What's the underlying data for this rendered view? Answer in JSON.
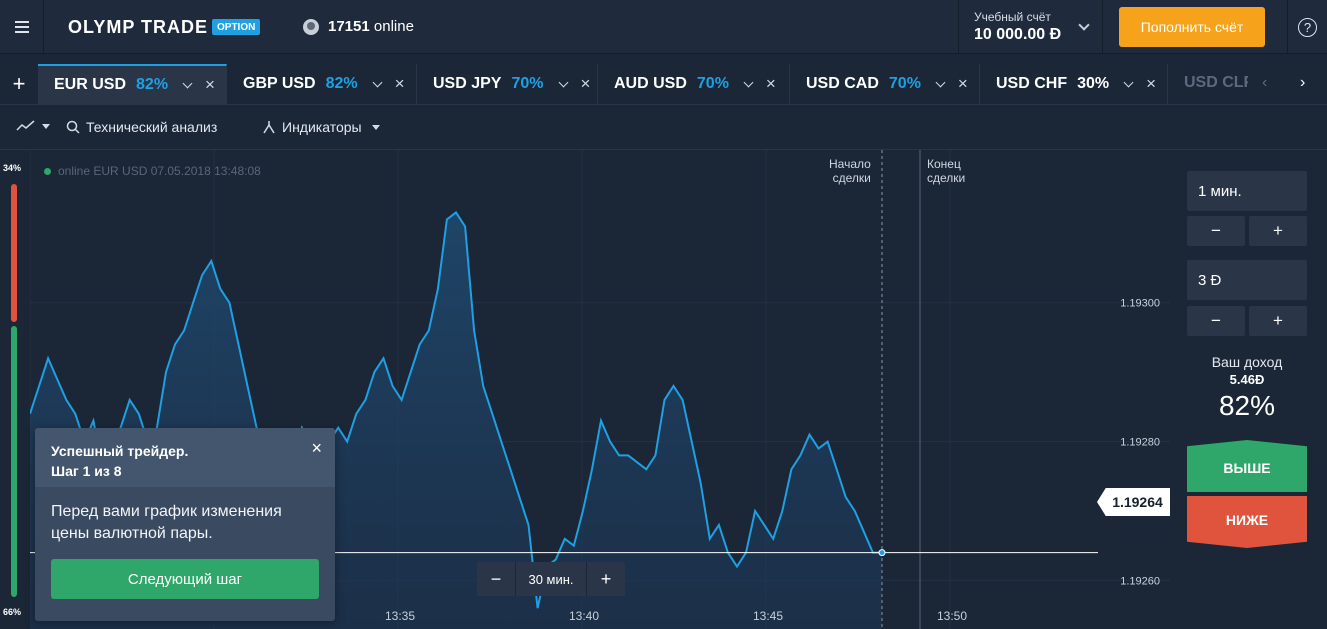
{
  "header": {
    "logo_text": "OLYMP TRADE",
    "logo_badge": "OPTION",
    "online_count": "17151",
    "online_label": "online",
    "account_label": "Учебный счёт",
    "account_balance": "10 000.00 Đ",
    "deposit_label": "Пополнить счёт",
    "help_symbol": "?"
  },
  "tabs": [
    {
      "name": "EUR USD",
      "pct": "82%",
      "active": true
    },
    {
      "name": "GBP USD",
      "pct": "82%"
    },
    {
      "name": "USD JPY",
      "pct": "70%"
    },
    {
      "name": "AUD USD",
      "pct": "70%"
    },
    {
      "name": "USD CAD",
      "pct": "70%"
    },
    {
      "name": "USD CHF",
      "pct": "30%"
    }
  ],
  "tab_faded": "USD CLP",
  "toolbar": {
    "tech_analysis": "Технический анализ",
    "indicators": "Индикаторы"
  },
  "sentiment": {
    "top_pct": "34%",
    "bottom_pct": "66%",
    "up_fraction": 0.66
  },
  "chart_info": "online EUR USD  07.05.2018 13:48:08",
  "deal_start_label": [
    "Начало",
    "сделки"
  ],
  "deal_end_label": [
    "Конец",
    "сделки"
  ],
  "current_price": "1.19264",
  "zoom": {
    "minus": "−",
    "label": "30 мин.",
    "plus": "+"
  },
  "tutorial": {
    "title_line1": "Успешный трейдер.",
    "title_line2": "Шаг 1 из 8",
    "body": "Перед вами график изменения цены валютной пары.",
    "button": "Следующий шаг",
    "close": "×"
  },
  "right_panel": {
    "time_value": "1 мин.",
    "amount_value": "3 Đ",
    "minus": "−",
    "plus": "+",
    "income_label": "Ваш доход",
    "income_value": "5.46Đ",
    "income_pct": "82%",
    "up_label": "ВЫШЕ",
    "down_label": "НИЖЕ"
  },
  "colors": {
    "accent": "#1fa0e3",
    "up": "#2fa66a",
    "down": "#e0533d",
    "deposit": "#f7a21b"
  },
  "chart_data": {
    "type": "area",
    "x_ticks": [
      "13:35",
      "13:40",
      "13:45",
      "13:50"
    ],
    "y_ticks": [
      "1.19300",
      "1.19280",
      "1.19260"
    ],
    "ylim": [
      1.19253,
      1.19322
    ],
    "deal_start_time": "13:48",
    "deal_end_time": "13:49",
    "current_value": 1.19264,
    "series": [
      {
        "values": [
          1.19284,
          1.19288,
          1.19292,
          1.19289,
          1.19286,
          1.19284,
          1.1928,
          1.19283,
          1.19276,
          1.1928,
          1.19282,
          1.19286,
          1.19284,
          1.1928,
          1.19282,
          1.1929,
          1.19294,
          1.19296,
          1.193,
          1.19304,
          1.19306,
          1.19302,
          1.193,
          1.19294,
          1.19288,
          1.19282,
          1.1928,
          1.19278,
          1.19276,
          1.19278,
          1.19282,
          1.19279,
          1.19277,
          1.1928,
          1.19282,
          1.1928,
          1.19284,
          1.19286,
          1.1929,
          1.19292,
          1.19288,
          1.19286,
          1.1929,
          1.19294,
          1.19296,
          1.19302,
          1.19312,
          1.19313,
          1.19311,
          1.19296,
          1.19288,
          1.19284,
          1.1928,
          1.19276,
          1.19272,
          1.19268,
          1.19256,
          1.19262,
          1.19263,
          1.19266,
          1.19265,
          1.1927,
          1.19276,
          1.19283,
          1.1928,
          1.19278,
          1.19278,
          1.19277,
          1.19276,
          1.19278,
          1.19286,
          1.19288,
          1.19286,
          1.1928,
          1.19274,
          1.19266,
          1.19268,
          1.19264,
          1.19262,
          1.19264,
          1.1927,
          1.19268,
          1.19266,
          1.1927,
          1.19276,
          1.19278,
          1.19281,
          1.19279,
          1.1928,
          1.19276,
          1.19272,
          1.1927,
          1.19267,
          1.19264,
          1.19264
        ]
      }
    ]
  }
}
